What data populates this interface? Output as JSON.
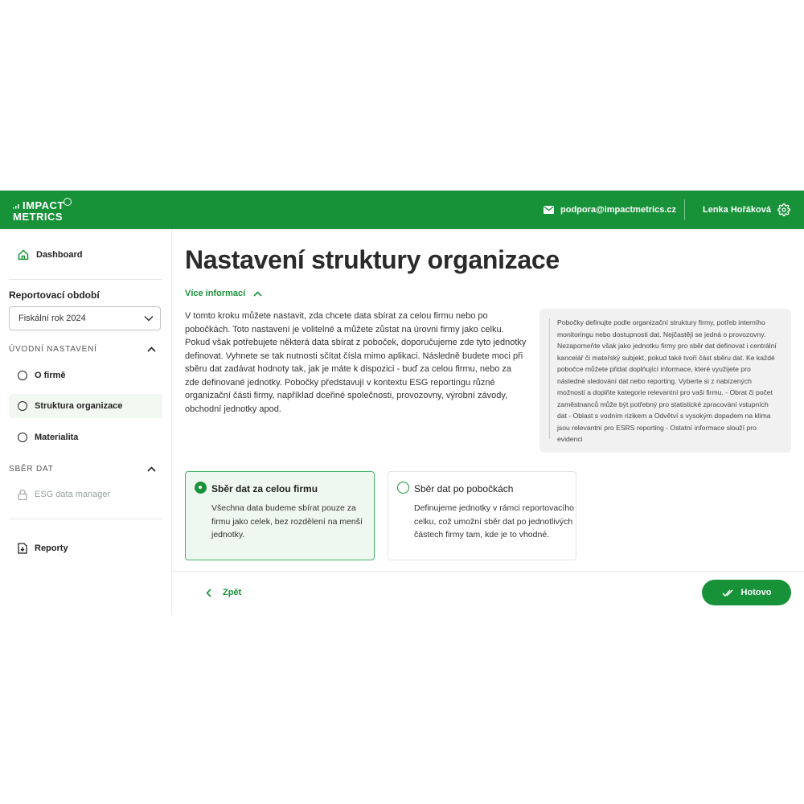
{
  "header": {
    "logo_line1": "IMPACT",
    "logo_line2": "METRICS",
    "support_email": "podpora@impactmetrics.cz",
    "user_name": "Lenka Hořáková"
  },
  "sidebar": {
    "dashboard_label": "Dashboard",
    "period_label": "Reportovací období",
    "period_value": "Fiskální rok 2024",
    "group_intro": "ÚVODNÍ NASTAVENÍ",
    "intro_items": [
      "O firmě",
      "Struktura organizace",
      "Materialita"
    ],
    "group_data": "SBĚR DAT",
    "data_items": [
      "ESG data manager"
    ],
    "reports_label": "Reporty"
  },
  "main": {
    "title": "Nastavení struktury organizace",
    "more_info": "Více informací",
    "intro_text": "V tomto kroku můžete nastavit, zda chcete data sbírat za celou firmu nebo po pobočkách. Toto nastavení je volitelné a můžete zůstat na úrovni firmy jako celku. Pokud však potřebujete některá data sbírat z poboček, doporučujeme zde tyto jednotky definovat. Vyhnete se tak nutnosti sčítat čísla mimo aplikaci. Následně budete moci při sběru dat zadávat hodnoty tak, jak je máte k dispozici - buď za celou firmu, nebo za zde definované jednotky. Pobočky představují v kontextu ESG reportingu různé organizační části firmy, například dceřiné společnosti, provozovny, výrobní závody, obchodní jednotky apod.",
    "info_box_text": "Pobočky definujte podle organizační struktury firmy, potřeb interního monitoringu nebo dostupnosti dat. Nejčastěji se jedná o provozovny. Nezapomeňte však jako jednotku firmy pro sběr dat definovat i centrální kancelář či mateřský subjekt, pokud také tvoří část sběru dat. Ke každé pobočce můžete přidat doplňující informace, které využijete pro následné sledování dat nebo reporting. Vyberte si z nabízených možností a doplňte kategorie relevantní pro vaši firmu. - Obrat či počet zaměstnanců může být potřebný pro statistické zpracování vstupních dat - Oblast s vodním rizikem a Odvětví s vysokým dopadem na klima jsou relevantní pro ESRS reporting - Ostatní informace slouží pro evidenci",
    "options": [
      {
        "title": "Sběr dat za celou firmu",
        "desc": "Všechna data budeme sbírat pouze za firmu jako celek, bez rozdělení na menší jednotky.",
        "selected": true
      },
      {
        "title": "Sběr dat po pobočkách",
        "desc": "Definujeme jednotky v rámci reportovacího celku, což umožní sběr dat po jednotlivých částech firmy tam, kde je to vhodné.",
        "selected": false
      }
    ],
    "back_label": "Zpět",
    "done_label": "Hotovo"
  },
  "colors": {
    "brand": "#179239",
    "selected_bg": "#eef8f0",
    "info_bg": "#f1f1f1"
  },
  "icons": [
    "logo-dots-icon",
    "mail-icon",
    "gear-icon",
    "home-icon",
    "chevron-down-icon",
    "chevron-up-icon",
    "lock-icon",
    "report-icon",
    "chevron-left-icon",
    "double-check-icon"
  ]
}
